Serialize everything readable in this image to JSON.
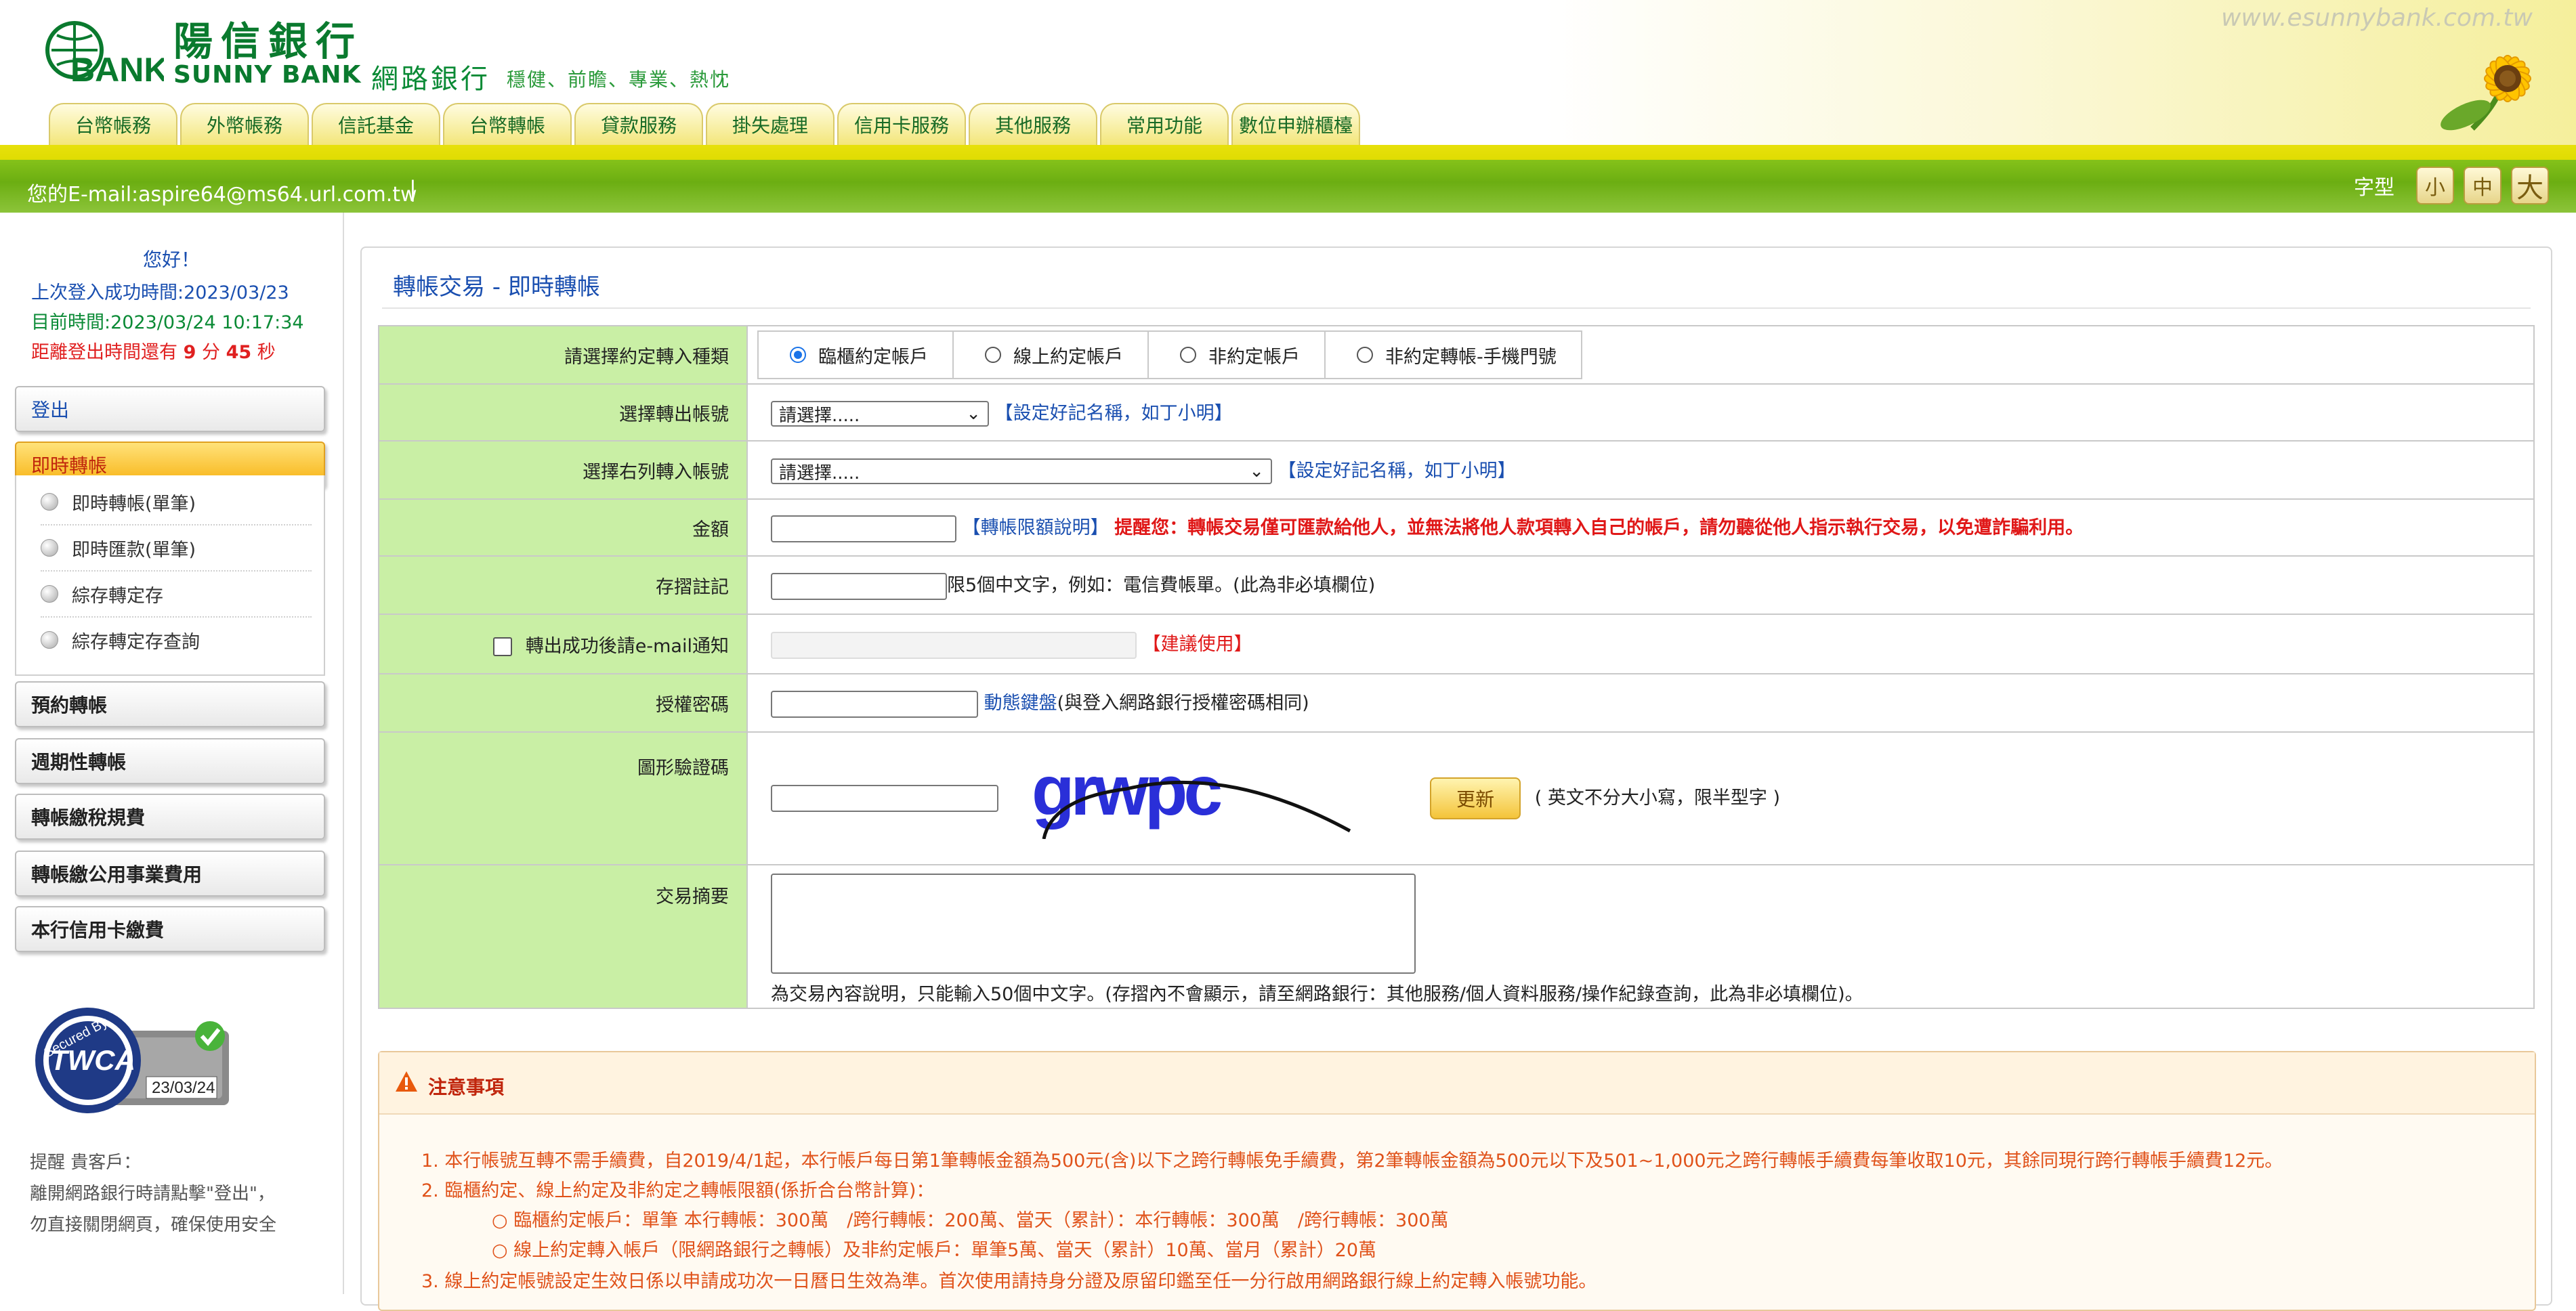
{
  "header": {
    "bank_name_cn": "陽信銀行",
    "bank_name_en": "SUNNY BANK",
    "netbank_label": "網路銀行",
    "slogan": "穩健、前瞻、專業、熱忱",
    "site_url": "www.esunnybank.com.tw",
    "logo_text": "BANK"
  },
  "nav": {
    "tabs": [
      "台幣帳務",
      "外幣帳務",
      "信託基金",
      "台幣轉帳",
      "貸款服務",
      "掛失處理",
      "信用卡服務",
      "其他服務",
      "常用功能",
      "數位申辦櫃檯"
    ]
  },
  "bar": {
    "email": "您的E-mail:aspire64@ms64.url.com.tw",
    "separator": "|",
    "font_label": "字型",
    "font_small": "小",
    "font_mid": "中",
    "font_big": "大"
  },
  "sidebar": {
    "greeting": "您好！",
    "last_login": "上次登入成功時間:2023/03/23",
    "current_time": "目前時間:2023/03/24 10:17:34",
    "logout_prefix": "距離登出時間還有",
    "logout_min": "9",
    "logout_min_unit": "分",
    "logout_sec": "45",
    "logout_sec_unit": "秒",
    "menu": {
      "logout": "登出",
      "instant": "即時轉帳",
      "scheduled": "預約轉帳",
      "periodic": "週期性轉帳",
      "tax": "轉帳繳稅規費",
      "utility": "轉帳繳公用事業費用",
      "credit_card": "本行信用卡繳費"
    },
    "submenu": [
      "即時轉帳(單筆)",
      "即時匯款(單筆)",
      "綜存轉定存",
      "綜存轉定存查詢"
    ],
    "badge": {
      "secured_by": "Secured By",
      "brand": "TWCA",
      "date": "23/03/24"
    },
    "reminder": [
      "提醒 貴客戶：",
      "離開網路銀行時請點擊\"登出\"，",
      "勿直接關閉網頁，確保使用安全"
    ]
  },
  "main": {
    "title": "轉帳交易 - 即時轉帳",
    "rows": {
      "type_label": "請選擇約定轉入種類",
      "type_options": [
        "臨櫃約定帳戶",
        "線上約定帳戶",
        "非約定帳戶",
        "非約定轉帳-手機門號"
      ],
      "type_selected": 0,
      "from_label": "選擇轉出帳號",
      "from_select": "請選擇.....",
      "nickname_link": "【設定好記名稱，如丁小明】",
      "to_label": "選擇右列轉入帳號",
      "to_select": "請選擇.....",
      "amount_label": "金額",
      "limit_link": "【轉帳限額說明】",
      "amount_warning": "提醒您：轉帳交易僅可匯款給他人，並無法將他人款項轉入自己的帳戶，請勿聽從他人指示執行交易，以免遭詐騙利用。",
      "memo_label": "存摺註記",
      "memo_hint": "限5個中文字，例如：電信費帳單。(此為非必填欄位)",
      "email_notify_label": "轉出成功後請e-mail通知",
      "suggest_link": "【建議使用】",
      "password_label": "授權密碼",
      "dynamic_keyboard": "動態鍵盤",
      "password_hint": "(與登入網路銀行授權密碼相同)",
      "captcha_label": "圖形驗證碼",
      "captcha_text": "grwpc",
      "refresh_button": "更新",
      "captcha_hint": "( 英文不分大小寫，限半型字 )",
      "summary_label": "交易摘要",
      "summary_hint": "為交易內容說明，只能輸入50個中文字。(存摺內不會顯示，請至網路銀行：其他服務/個人資料服務/操作紀錄查詢，此為非必填欄位)。"
    },
    "notice": {
      "title": "注意事項",
      "lines": [
        "1. 本行帳號互轉不需手續費，自2019/4/1起，本行帳戶每日第1筆轉帳金額為500元(含)以下之跨行轉帳免手續費，第2筆轉帳金額為500元以下及501~1,000元之跨行轉帳手續費每筆收取10元，其餘同現行跨行轉帳手續費12元。",
        "2. 臨櫃約定、線上約定及非約定之轉帳限額(係折合台幣計算)：",
        "○ 臨櫃約定帳戶：單筆 本行轉帳：300萬　/跨行轉帳：200萬、當天（累計）：本行轉帳：300萬　/跨行轉帳：300萬",
        "○ 線上約定轉入帳戶（限網路銀行之轉帳）及非約定帳戶：單筆5萬、當天（累計）10萬、當月（累計）20萬",
        "3. 線上約定帳號設定生效日係以申請成功次一日曆日生效為準。首次使用請持身分證及原留印鑑至任一分行啟用網路銀行線上約定轉入帳號功能。"
      ]
    }
  },
  "colors": {
    "brand_green": "#0a7a2e",
    "form_label_bg": "#c9efa5",
    "link_blue": "#1a4fb0",
    "warning_red": "#e01818",
    "notice_orange": "#e0521a",
    "active_menu": "#f7b10f"
  },
  "icons": {
    "warning": "warning-triangle-icon",
    "select_arrow": "chevron-down-icon",
    "menu_bullet": "bullet-icon"
  }
}
